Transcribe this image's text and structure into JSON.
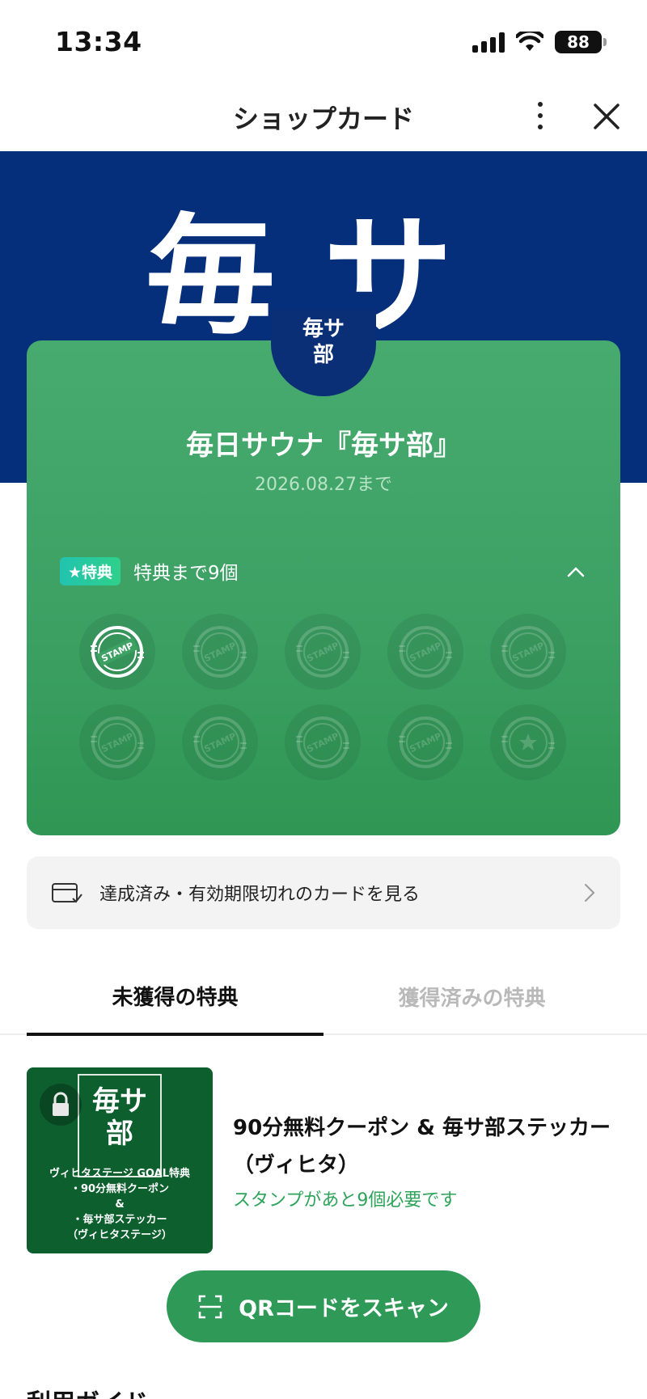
{
  "status_bar": {
    "time": "13:34",
    "battery": "88"
  },
  "header": {
    "title": "ショップカード"
  },
  "hero": {
    "logo_text": "毎サ"
  },
  "card": {
    "badge_line1": "毎サ",
    "badge_line2": "部",
    "title": "毎日サウナ『毎サ部』",
    "expiry": "2026.08.27まで",
    "reward_badge": "★特典",
    "reward_progress": "特典まで9個",
    "stamps_total": 10,
    "stamps_collected": 1,
    "stamp_label": "STAMP"
  },
  "history_link": {
    "label": "達成済み・有効期限切れのカードを見る"
  },
  "tabs": [
    {
      "label": "未獲得の特典",
      "active": true
    },
    {
      "label": "獲得済みの特典",
      "active": false
    }
  ],
  "reward": {
    "thumb_logo_line1": "毎サ",
    "thumb_logo_line2": "部",
    "thumb_caption_1": "ヴィヒタステージ GOAL特典",
    "thumb_caption_2": "・90分無料クーポン",
    "thumb_caption_3": "&",
    "thumb_caption_4": "・毎サ部ステッカー",
    "thumb_caption_5": "（ヴィヒタステージ）",
    "name": "90分無料クーポン & 毎サ部ステッカー（ヴィヒタ）",
    "requirement": "スタンプがあと9個必要です"
  },
  "scan_button": {
    "label": "QRコードをスキャン"
  },
  "guide": {
    "title": "利用ガイド"
  },
  "colors": {
    "hero": "#062f7b",
    "card_green": "#3da164",
    "accent_green": "#2f9a58",
    "reward_badge": "#22c3b0"
  }
}
